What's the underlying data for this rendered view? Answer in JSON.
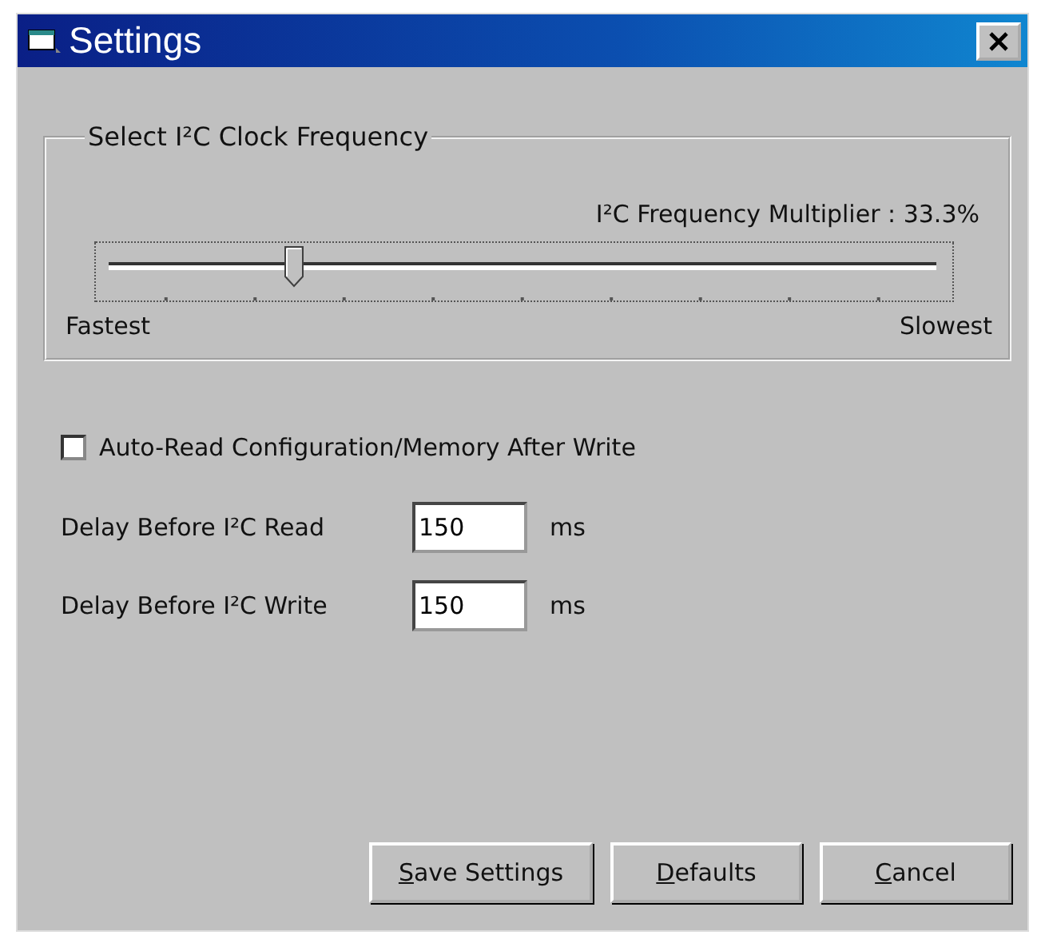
{
  "window": {
    "title": "Settings"
  },
  "clock_group": {
    "title": "Select I²C Clock Frequency",
    "reading": "I²C Frequency Multiplier : 33.3%",
    "slider": {
      "level": 0.23,
      "min_label": "Fastest",
      "max_label": "Slowest"
    }
  },
  "auto_read": {
    "label": "Auto-Read Configuration/Memory After Write",
    "checked": false
  },
  "delays": [
    {
      "label": "Delay Before I²C Read",
      "value": "150",
      "unit": "ms"
    },
    {
      "label": "Delay Before I²C Write",
      "value": "150",
      "unit": "ms"
    }
  ],
  "buttons": [
    {
      "mnemonic": "S",
      "rest": "ave Settings"
    },
    {
      "mnemonic": "D",
      "rest": "efaults"
    },
    {
      "mnemonic": "C",
      "rest": "ancel"
    }
  ]
}
